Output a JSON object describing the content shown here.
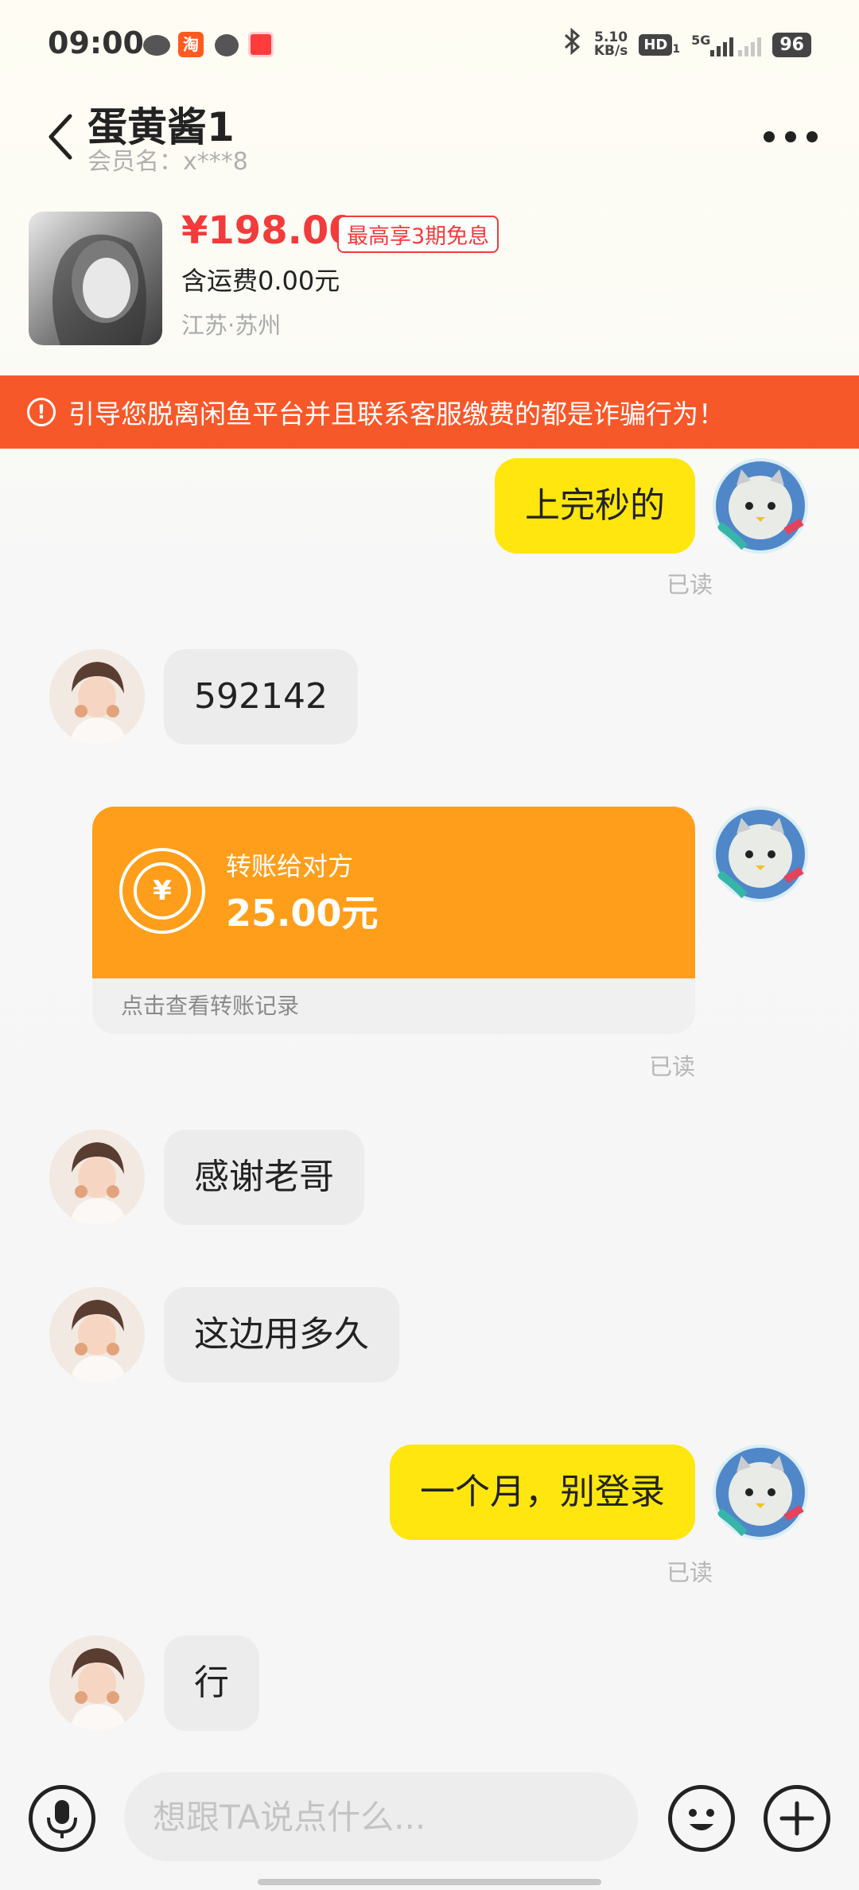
{
  "status_bar": {
    "time": "09:00",
    "taobao_glyph": "淘",
    "speed_top": "5.10",
    "speed_bottom": "KB/s",
    "hd": "HD",
    "hd_sub": "1",
    "network": "5G",
    "battery": "96",
    "icons": [
      "wechat-icon",
      "taobao-icon",
      "message-icon",
      "app-icon",
      "bluetooth-icon",
      "signal-icon",
      "battery-icon"
    ]
  },
  "header": {
    "title": "蛋黄酱1",
    "member": "会员名：x***8",
    "back_icon": "back-arrow-icon",
    "more_icon": "more-icon"
  },
  "product": {
    "price": "¥198.00",
    "badge": "最高享3期免息",
    "shipping": "含运费0.00元",
    "location": "江苏·苏州"
  },
  "warning": {
    "text": "引导您脱离闲鱼平台并且联系客服缴费的都是诈骗行为！"
  },
  "messages": [
    {
      "from": "me",
      "text": "上完秒的",
      "status": "已读"
    },
    {
      "from": "them",
      "text": "592142"
    },
    {
      "from": "me",
      "type": "transfer",
      "label": "转账给对方",
      "amount": "25.00元",
      "link": "点击查看转账记录",
      "status": "已读"
    },
    {
      "from": "them",
      "text": "感谢老哥"
    },
    {
      "from": "them",
      "text": "这边用多久"
    },
    {
      "from": "me",
      "text": "一个月，别登录",
      "status": "已读"
    },
    {
      "from": "them",
      "text": "行"
    }
  ],
  "input": {
    "placeholder": "想跟TA说点什么..."
  },
  "colors": {
    "accent_yellow": "#ffe60f",
    "warning_orange": "#f75829",
    "price_red": "#f23b3b",
    "transfer_orange": "#ff9e1a"
  }
}
